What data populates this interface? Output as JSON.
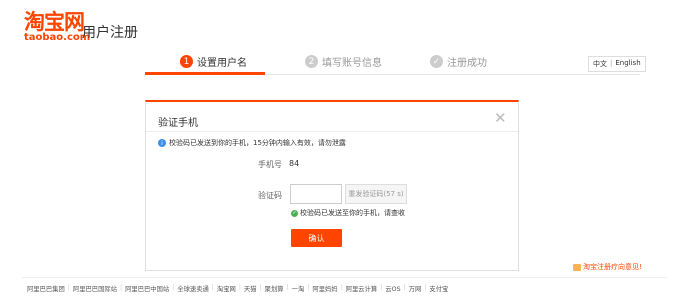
{
  "header": {
    "logo_main": "淘宝网",
    "logo_sub": "taobao.com",
    "title": "用户注册"
  },
  "steps": [
    {
      "num": "1",
      "label": "设置用户名",
      "active": true
    },
    {
      "num": "2",
      "label": "填写账号信息",
      "active": false
    },
    {
      "num": "✓",
      "label": "注册成功",
      "active": false
    }
  ],
  "lang": {
    "zh": "中文",
    "sep": "|",
    "en": "English"
  },
  "dialog": {
    "title": "验证手机",
    "close": "✕",
    "info_icon": "i",
    "info": "校验码已发送到你的手机，15分钟内输入有效，请勿泄露",
    "phone_label": "手机号",
    "phone_value": "84",
    "code_label": "验证码",
    "code_value": "",
    "resend_label": "重发验证码(57 s)",
    "sent_icon": "✓",
    "sent_text": "校验码已发送至你的手机，请查收",
    "confirm_label": "确认"
  },
  "feedback": {
    "label": "淘宝注册疗向意见!"
  },
  "footer": {
    "links": [
      "阿里巴巴集团",
      "阿里巴巴国际站",
      "阿里巴巴中国站",
      "全球速卖通",
      "淘宝网",
      "天猫",
      "聚划算",
      "一淘",
      "阿里妈妈",
      "阿里云计算",
      "云OS",
      "万网",
      "支付宝"
    ]
  },
  "colors": {
    "accent": "#ff4400",
    "info": "#3c8ee6",
    "success": "#4caf50"
  }
}
